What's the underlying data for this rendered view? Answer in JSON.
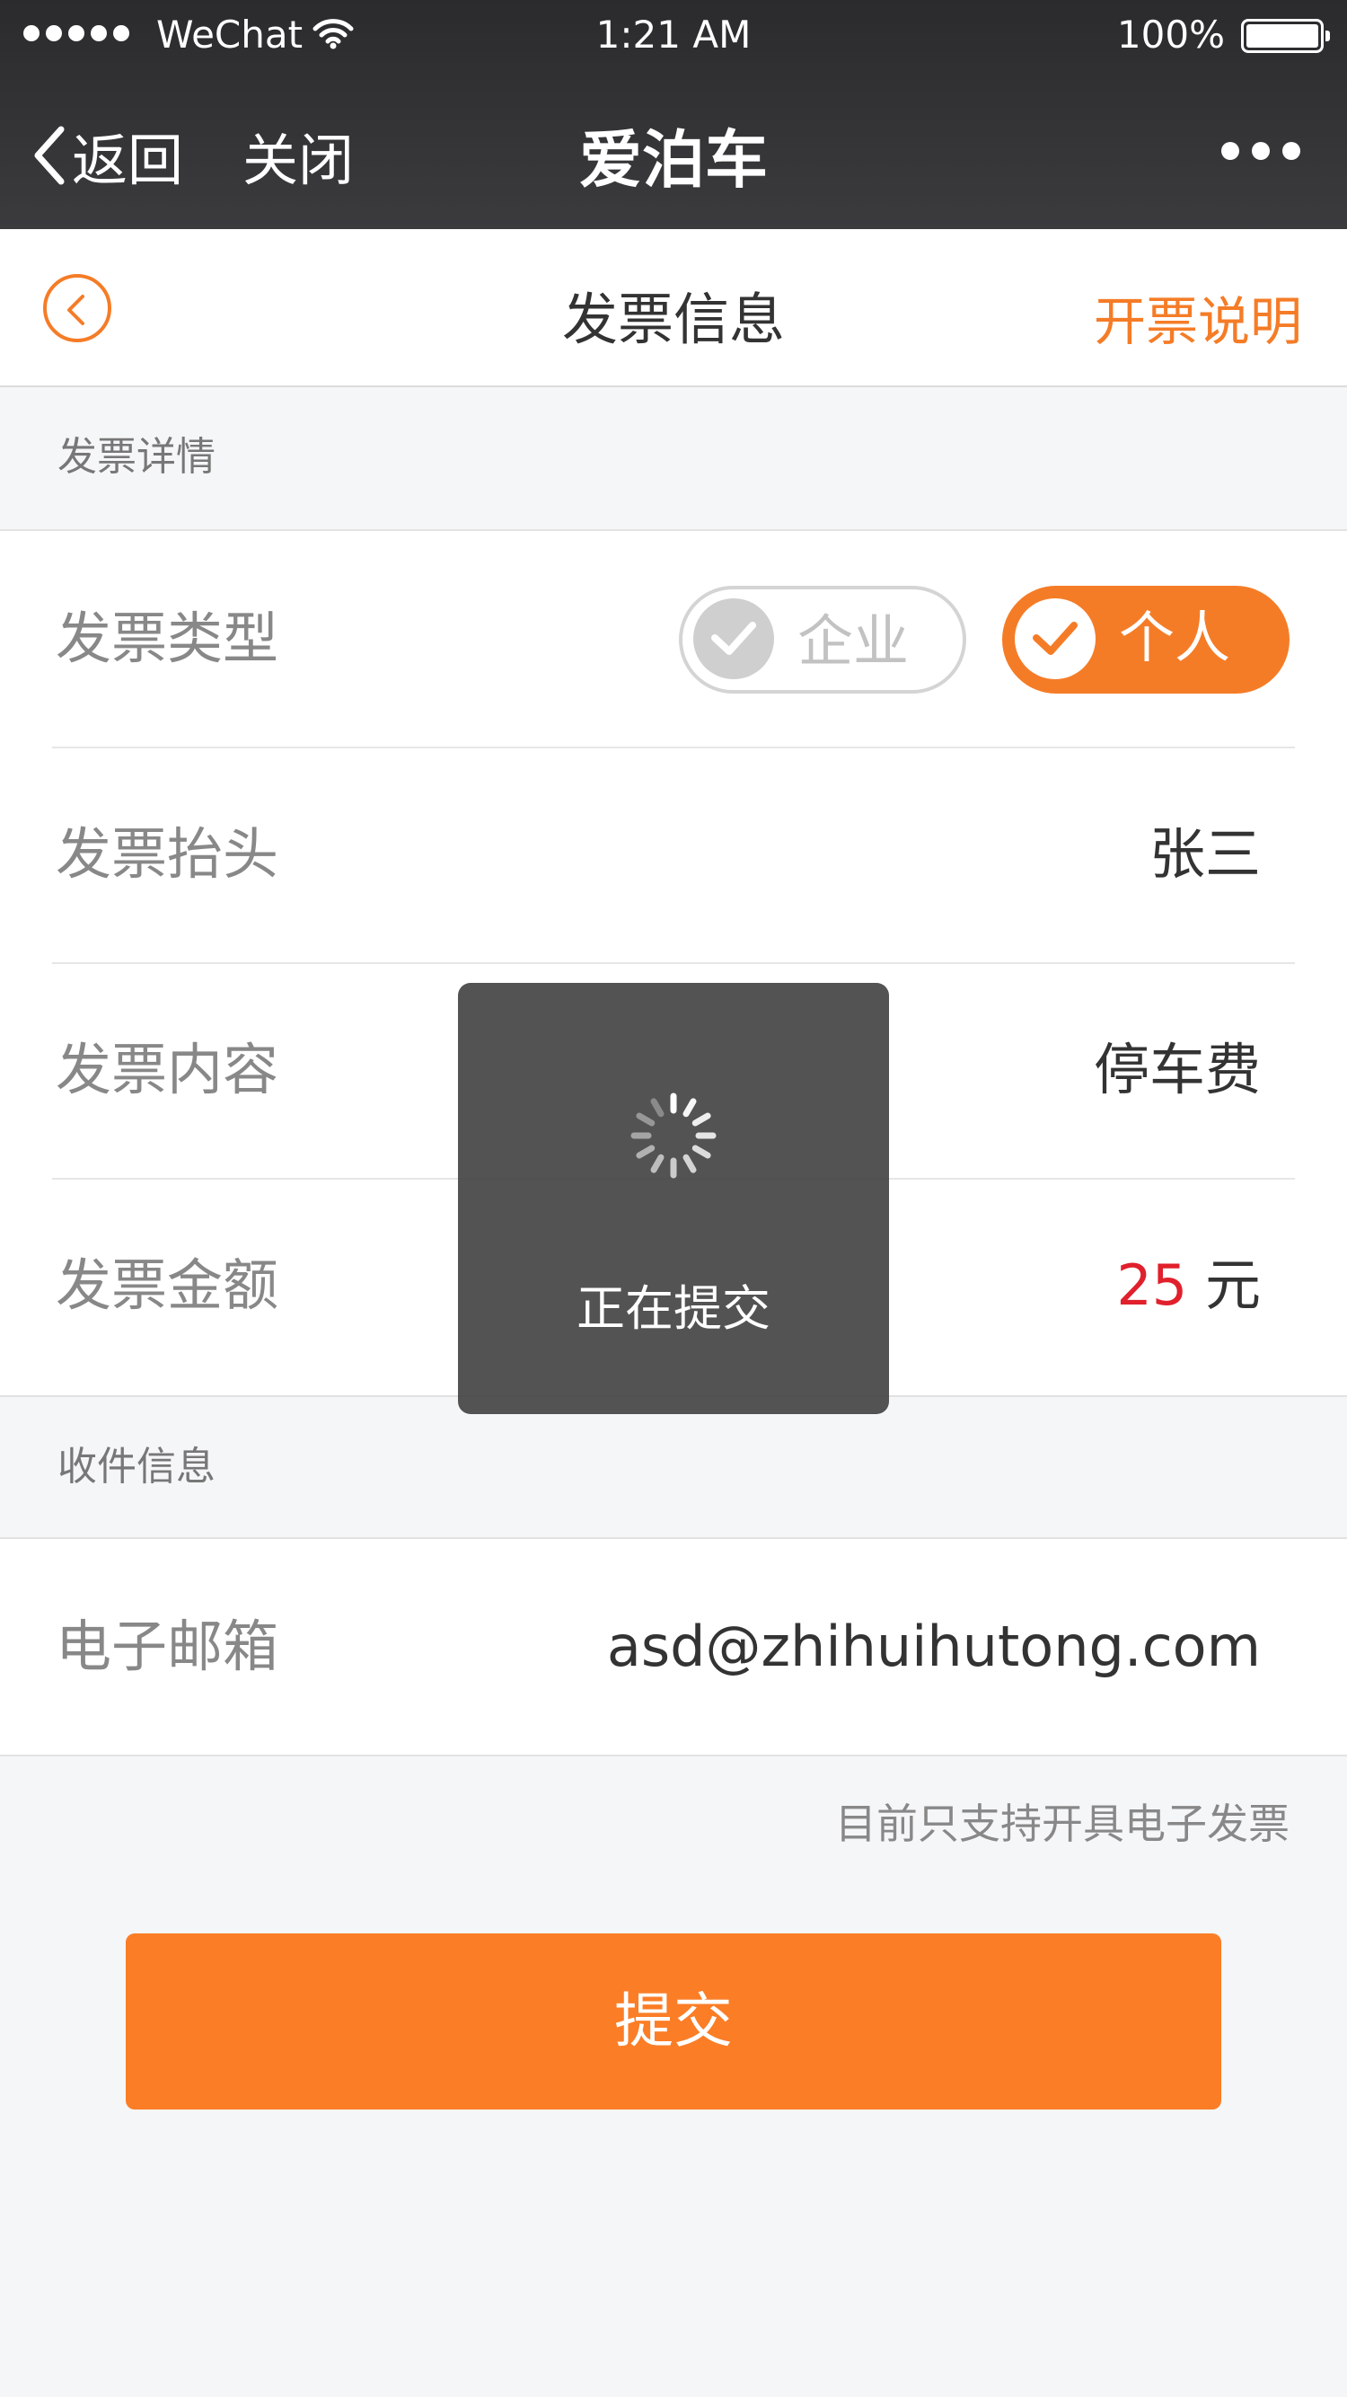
{
  "status_bar": {
    "carrier": "WeChat",
    "time": "1:21 AM",
    "battery": "100%"
  },
  "wechat_nav": {
    "back_label": "返回",
    "close_label": "关闭",
    "title": "爱泊车"
  },
  "page": {
    "title": "发票信息",
    "help_link": "开票说明"
  },
  "invoice_details": {
    "section_title": "发票详情",
    "type_label": "发票类型",
    "type_options": [
      "企业",
      "个人"
    ],
    "selected_type": "个人",
    "header_label": "发票抬头",
    "header_value": "张三",
    "content_label": "发票内容",
    "content_value": "停车费",
    "amount_label": "发票金额",
    "amount_value": "25",
    "amount_unit": "元"
  },
  "recipient": {
    "section_title": "收件信息",
    "email_label": "电子邮箱",
    "email_value": "asd@zhihuihutong.com"
  },
  "note": "目前只支持开具电子发票",
  "submit_label": "提交",
  "loading_toast": {
    "text": "正在提交"
  },
  "colors": {
    "accent": "#f57c27",
    "button": "#fb7d26",
    "amount": "#e0202c",
    "nav_bg": "#333335"
  }
}
